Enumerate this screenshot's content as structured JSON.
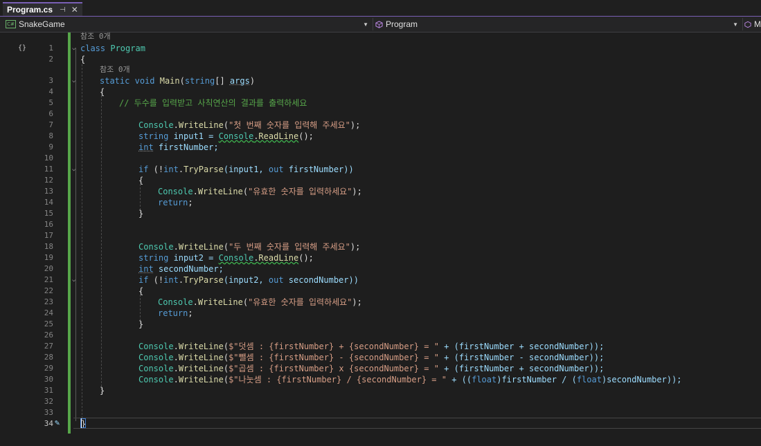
{
  "tab": {
    "title": "Program.cs",
    "pin_icon": "pin-icon",
    "close_icon": "close-icon"
  },
  "navbar": {
    "project": "SnakeGame",
    "type": "Program",
    "member": "M"
  },
  "refs": [
    "참조 0개",
    "참조 0개"
  ],
  "lines": [
    {
      "n": "1"
    },
    {
      "n": "2"
    },
    {
      "n": "3"
    },
    {
      "n": "4"
    },
    {
      "n": "5"
    },
    {
      "n": "6"
    },
    {
      "n": "7"
    },
    {
      "n": "8"
    },
    {
      "n": "9"
    },
    {
      "n": "10"
    },
    {
      "n": "11"
    },
    {
      "n": "12"
    },
    {
      "n": "13"
    },
    {
      "n": "14"
    },
    {
      "n": "15"
    },
    {
      "n": "16"
    },
    {
      "n": "17"
    },
    {
      "n": "18"
    },
    {
      "n": "19"
    },
    {
      "n": "20"
    },
    {
      "n": "21"
    },
    {
      "n": "22"
    },
    {
      "n": "23"
    },
    {
      "n": "24"
    },
    {
      "n": "25"
    },
    {
      "n": "26"
    },
    {
      "n": "27"
    },
    {
      "n": "28"
    },
    {
      "n": "29"
    },
    {
      "n": "30"
    },
    {
      "n": "31"
    },
    {
      "n": "32"
    },
    {
      "n": "33"
    },
    {
      "n": "34"
    }
  ],
  "code": {
    "l1_kw": "class",
    "l1_ty": "Program",
    "l2": "{",
    "l3_kw1": "static",
    "l3_kw2": "void",
    "l3_me": "Main",
    "l3_p1": "(",
    "l3_kw3": "string",
    "l3_p2": "[] ",
    "l3_pa": "args",
    "l3_p3": ")",
    "l4": "{",
    "l5": "// 두수를 입력받고 사칙연산의 결과를 출력하세요",
    "l7_ty": "Console",
    "l7_dot": ".",
    "l7_me": "WriteLine",
    "l7_p1": "(",
    "l7_st": "\"첫 번째 숫자를 입력해 주세요\"",
    "l7_p2": ");",
    "l8_kw": "string",
    "l8_va": " input1 = ",
    "l8_ty": "Console",
    "l8_dot": ".",
    "l8_me": "ReadLine",
    "l8_p": "();",
    "l9_kw": "int",
    "l9_va": " firstNumber;",
    "l11_kw": "if",
    "l11_p1": " (!",
    "l11_kw2": "int",
    "l11_dot": ".",
    "l11_me": "TryParse",
    "l11_p2": "(input1, ",
    "l11_kw3": "out",
    "l11_p3": " firstNumber))",
    "l12": "{",
    "l13_ty": "Console",
    "l13_dot": ".",
    "l13_me": "WriteLine",
    "l13_p1": "(",
    "l13_st": "\"유효한 숫자를 입력하세요\"",
    "l13_p2": ");",
    "l14_kw": "return",
    "l14_p": ";",
    "l15": "}",
    "l18_ty": "Console",
    "l18_dot": ".",
    "l18_me": "WriteLine",
    "l18_p1": "(",
    "l18_st": "\"두 번째 숫자를 입력해 주세요\"",
    "l18_p2": ");",
    "l19_kw": "string",
    "l19_va": " input2 = ",
    "l19_ty": "Console",
    "l19_dot": ".",
    "l19_me": "ReadLine",
    "l19_p": "();",
    "l20_kw": "int",
    "l20_va": " secondNumber;",
    "l21_kw": "if",
    "l21_p1": " (!",
    "l21_kw2": "int",
    "l21_dot": ".",
    "l21_me": "TryParse",
    "l21_p2": "(input2, ",
    "l21_kw3": "out",
    "l21_p3": " secondNumber))",
    "l22": "{",
    "l23_ty": "Console",
    "l23_dot": ".",
    "l23_me": "WriteLine",
    "l23_p1": "(",
    "l23_st": "\"유효한 숫자를 입력하세요\"",
    "l23_p2": ");",
    "l24_kw": "return",
    "l24_p": ";",
    "l25": "}",
    "l27_ty": "Console",
    "l27_dot": ".",
    "l27_me": "WriteLine",
    "l27_p1": "(",
    "l27_st": "$\"덧셈 : {firstNumber} + {secondNumber} = \"",
    "l27_p2": " + (firstNumber + secondNumber));",
    "l28_ty": "Console",
    "l28_dot": ".",
    "l28_me": "WriteLine",
    "l28_p1": "(",
    "l28_st": "$\"뺄셈 : {firstNumber} - {secondNumber} = \"",
    "l28_p2": " + (firstNumber - secondNumber));",
    "l29_ty": "Console",
    "l29_dot": ".",
    "l29_me": "WriteLine",
    "l29_p1": "(",
    "l29_st": "$\"곱셈 : {firstNumber} x {secondNumber} = \"",
    "l29_p2": " + (firstNumber + secondNumber));",
    "l30_ty": "Console",
    "l30_dot": ".",
    "l30_me": "WriteLine",
    "l30_p1": "(",
    "l30_st": "$\"나눗셈 : {firstNumber} / {secondNumber} = \"",
    "l30_p2": " + ((",
    "l30_kw1": "float",
    "l30_p3": ")firstNumber / (",
    "l30_kw2": "float",
    "l30_p4": ")secondNumber));",
    "l31": "}",
    "l34": "}"
  },
  "colors": {
    "accent": "#7a5fb5",
    "change_bar": "#57a64a",
    "keyword": "#569cd6",
    "type": "#4ec9b0",
    "method": "#dcdcaa",
    "string": "#d69d85",
    "comment": "#57a64a"
  }
}
